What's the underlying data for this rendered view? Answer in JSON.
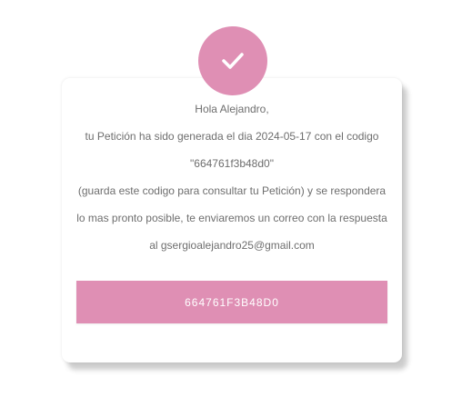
{
  "message": {
    "greeting": "Hola Alejandro,",
    "line1": "tu Petición ha sido generada el dia 2024-05-17 con el codigo",
    "code_quoted": "\"664761f3b48d0\"",
    "line3": "(guarda este codigo para consultar tu Petición) y se respondera",
    "line4": "lo mas pronto posible, te enviaremos un correo con la respuesta",
    "line5": "al gsergioalejandro25@gmail.com"
  },
  "button": {
    "label": "664761F3B48D0"
  },
  "icon": {
    "name": "check-icon"
  },
  "colors": {
    "accent": "#df8fb4",
    "text": "#6e6e6e"
  }
}
